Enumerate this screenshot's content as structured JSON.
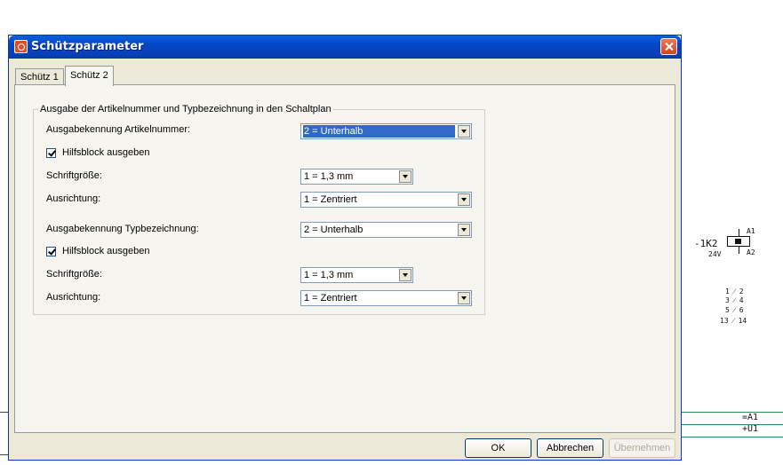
{
  "window": {
    "title": "Schützparameter",
    "close_icon": "close-icon"
  },
  "tabs": [
    {
      "label": "Schütz 1"
    },
    {
      "label": "Schütz 2"
    }
  ],
  "group": {
    "legend": "Ausgabe der Artikelnummer und Typbezeichnung in den Schaltplan",
    "rows": {
      "artikel_label": "Ausgabekennung Artikelnummer:",
      "artikel_value": "2 = Unterhalb",
      "hilfsblock1_label": "Hilfsblock ausgeben",
      "schrift1_label": "Schriftgröße:",
      "schrift1_value": "1 = 1,3 mm",
      "ausrichtung1_label": "Ausrichtung:",
      "ausrichtung1_value": "1 = Zentriert",
      "typ_label": "Ausgabekennung Typbezeichnung:",
      "typ_value": "2 = Unterhalb",
      "hilfsblock2_label": "Hilfsblock ausgeben",
      "schrift2_label": "Schriftgröße:",
      "schrift2_value": "1 = 1,3 mm",
      "ausrichtung2_label": "Ausrichtung:",
      "ausrichtung2_value": "1 = Zentriert"
    }
  },
  "buttons": {
    "ok": "OK",
    "cancel": "Abbrechen",
    "apply": "Übernehmen"
  },
  "schematic": {
    "device": "-1K2",
    "voltage": "24V",
    "a1": "A1",
    "a2": "A2",
    "contacts": [
      "1 ⁄ 2",
      "3 ⁄ 4",
      "5 ⁄ 6",
      "13 ⁄ 14"
    ],
    "terminal_a1": "=A1",
    "terminal_u1": "+U1"
  },
  "colors": {
    "titlebar": "#0a5fdc",
    "dialog_bg": "#ece9d8",
    "selection": "#316ac5"
  }
}
